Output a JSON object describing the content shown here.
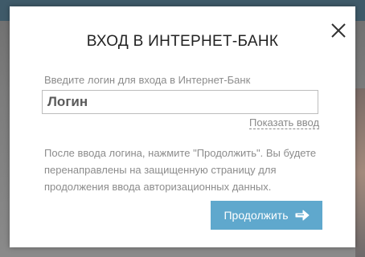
{
  "modal": {
    "title": "ВХОД В ИНТЕРНЕТ-БАНК",
    "close_icon": "close-icon",
    "login_label": "Введите логин для входа в Интернет-Банк",
    "login_placeholder": "Логин",
    "login_value": "",
    "show_input_link": "Показать ввод",
    "info_text": "После ввода логина, нажмите \"Продолжить\". Вы будете перенаправлены на защищенную страницу для продолжения ввода авторизационных данных.",
    "continue_button": "Продолжить",
    "continue_icon": "arrow-right-icon",
    "colors": {
      "button_bg": "#5fa8cd",
      "overlay": "#7f7f7f",
      "text_muted": "#8c8c8c"
    }
  }
}
